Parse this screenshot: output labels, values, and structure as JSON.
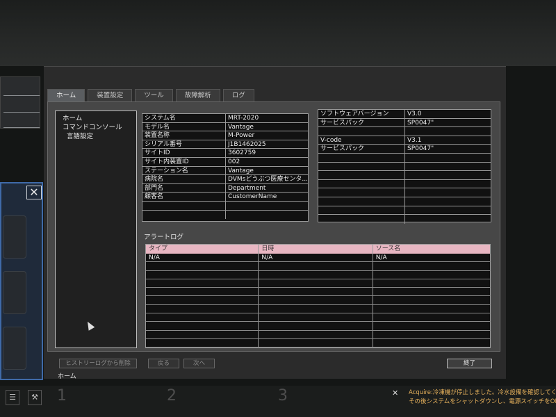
{
  "window": {
    "tabs": [
      {
        "label": "ホーム"
      },
      {
        "label": "装置設定"
      },
      {
        "label": "ツール"
      },
      {
        "label": "故障解析"
      },
      {
        "label": "ログ"
      }
    ],
    "active_tab": 0
  },
  "nav": {
    "items": [
      {
        "label": "ホーム"
      },
      {
        "label": "コマンドコンソール"
      },
      {
        "label": "言語設定"
      }
    ]
  },
  "system_info": {
    "rows": [
      {
        "key": "システム名",
        "value": "MRT-2020"
      },
      {
        "key": "モデル名",
        "value": "Vantage"
      },
      {
        "key": "装置名称",
        "value": "M-Power"
      },
      {
        "key": "シリアル番号",
        "value": "J1B1462025"
      },
      {
        "key": "サイトID",
        "value": "3602759"
      },
      {
        "key": "サイト内装置ID",
        "value": "002"
      },
      {
        "key": "ステーション名",
        "value": "Vantage"
      },
      {
        "key": "病院名",
        "value": "DVMsどうぶつ医療センタ..."
      },
      {
        "key": "部門名",
        "value": "Department"
      },
      {
        "key": "顧客名",
        "value": "CustomerName"
      },
      {
        "key": "",
        "value": ""
      },
      {
        "key": "",
        "value": ""
      }
    ]
  },
  "version_info": {
    "rows": [
      {
        "key": "ソフトウェアバージョン",
        "value": "V3.0"
      },
      {
        "key": "サービスパック",
        "value": "SP0047\""
      },
      {
        "key": "",
        "value": ""
      },
      {
        "key": "V-code",
        "value": "V3.1"
      },
      {
        "key": "サービスパック",
        "value": "SP0047\""
      },
      {
        "key": "",
        "value": ""
      },
      {
        "key": "",
        "value": ""
      },
      {
        "key": "",
        "value": ""
      },
      {
        "key": "",
        "value": ""
      },
      {
        "key": "",
        "value": ""
      },
      {
        "key": "",
        "value": ""
      },
      {
        "key": "",
        "value": ""
      },
      {
        "key": "",
        "value": ""
      }
    ]
  },
  "alarm_log": {
    "title": "アラートログ",
    "columns": [
      "タイプ",
      "日時",
      "ソース名"
    ],
    "rows": [
      [
        "N/A",
        "N/A",
        "N/A"
      ],
      [
        "",
        "",
        ""
      ],
      [
        "",
        "",
        ""
      ],
      [
        "",
        "",
        ""
      ],
      [
        "",
        "",
        ""
      ],
      [
        "",
        "",
        ""
      ],
      [
        "",
        "",
        ""
      ],
      [
        "",
        "",
        ""
      ],
      [
        "",
        "",
        ""
      ],
      [
        "",
        "",
        ""
      ],
      [
        "",
        "",
        ""
      ]
    ]
  },
  "buttons": {
    "delete_history": "ヒストリーログから削除",
    "back": "戻る",
    "next": "次へ",
    "exit": "終了"
  },
  "status_label": "ホーム",
  "taskbar": {
    "numbers": [
      "1",
      "2",
      "3"
    ],
    "close_glyph": "✕",
    "notice_line1": "Acquire:冷凍機が停止しました。冷水設備を確認してく",
    "notice_line2": "その後システムをシャットダウンし、電源スイッチをOFFにし"
  },
  "left_panel": {
    "close_glyph": "✕"
  }
}
